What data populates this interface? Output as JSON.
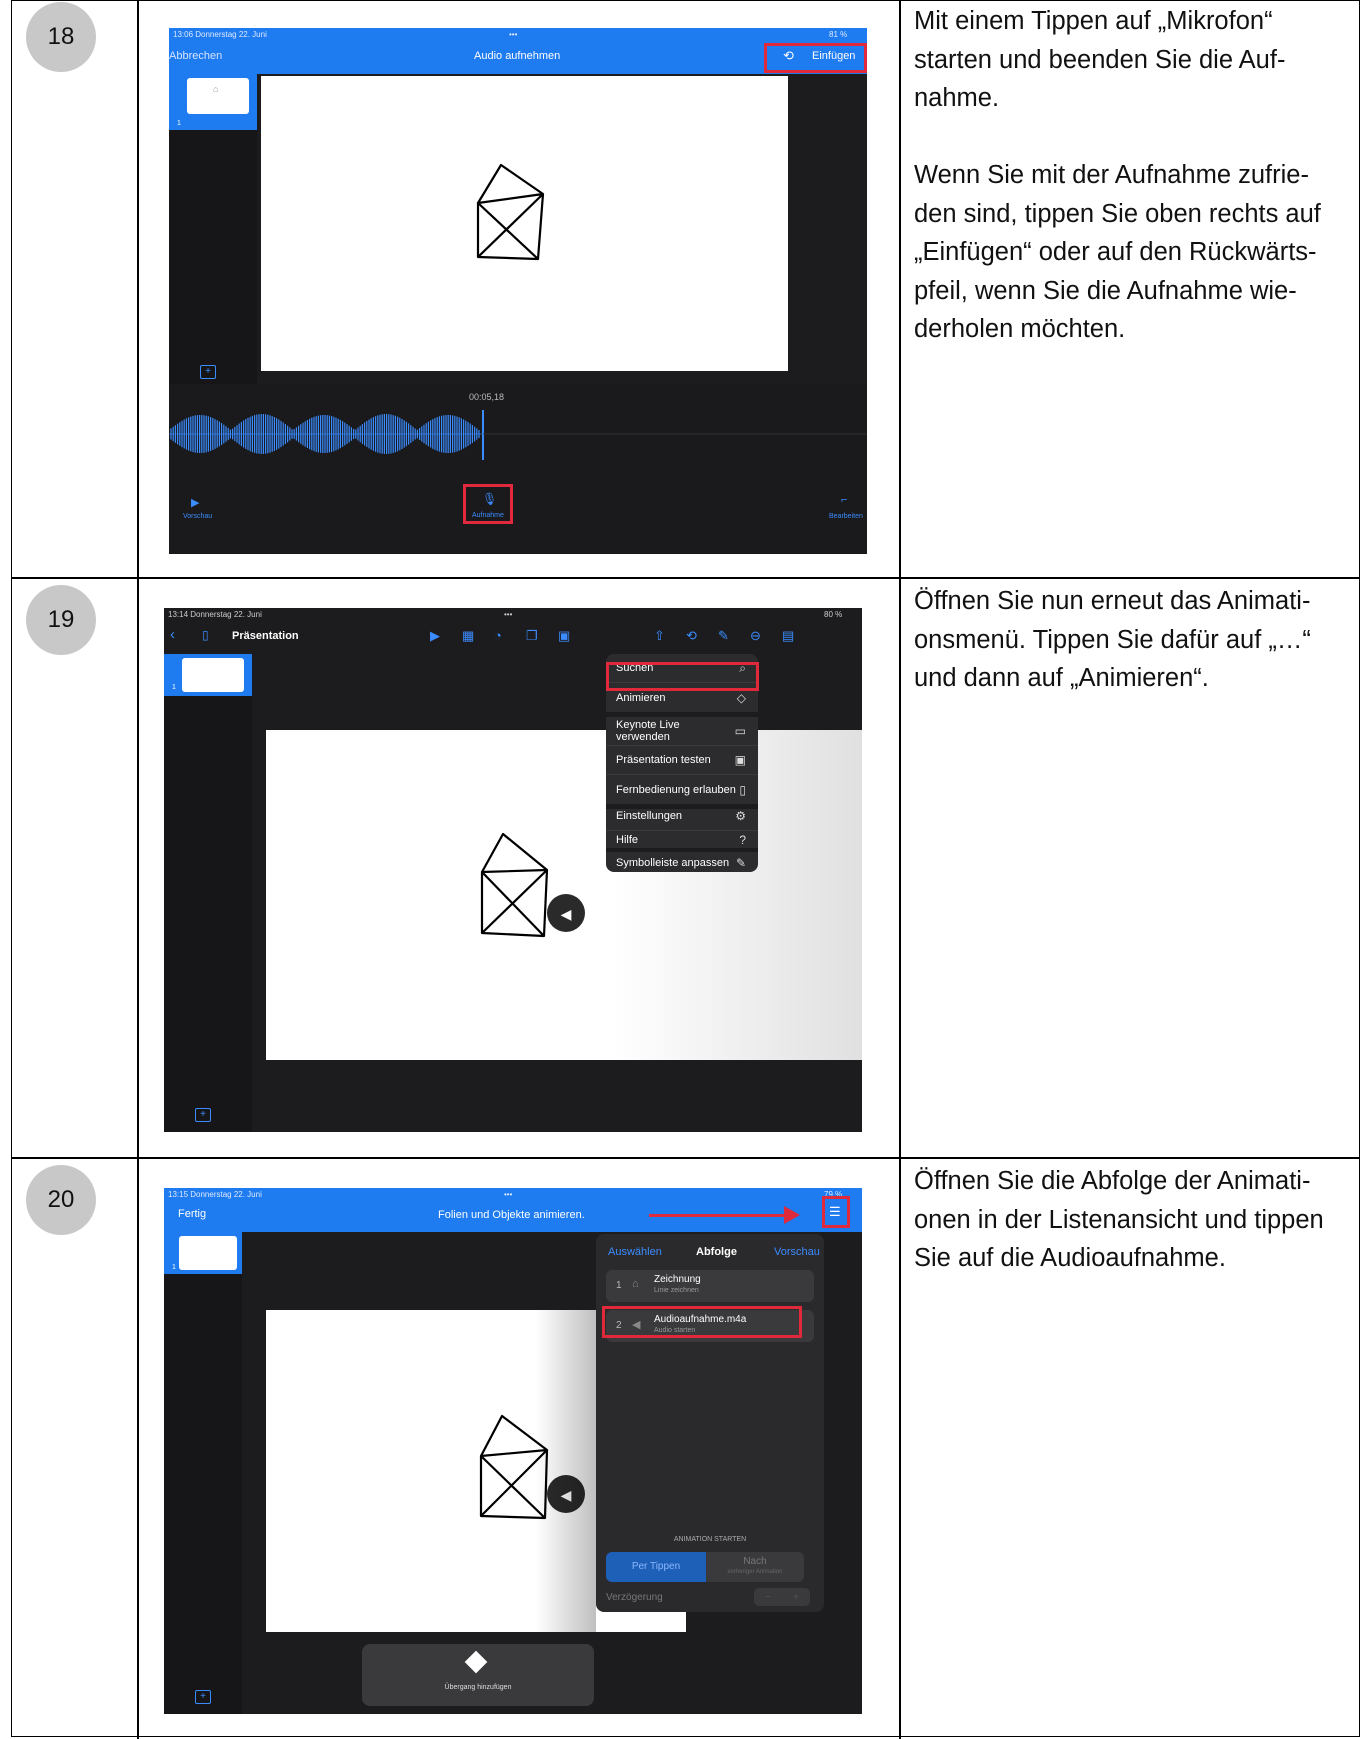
{
  "rows": [
    {
      "number": "18",
      "description": "Mit einem Tippen auf „Mikrofon“ starten und beenden Sie die Auf-\nnahme.\n\nWenn Sie mit der Aufnahme zufrie-\nden sind, tippen Sie oben rechts auf\n„Einfügen“ oder auf den Rückwärts-\npfeil, wenn Sie die Aufnahme wie-\nderholen möchten.",
      "screen": {
        "status_time": "13:06  Donnerstag 22. Juni",
        "status_dots": "•••",
        "status_battery": "81 %",
        "cancel": "Abbrechen",
        "title": "Audio aufnehmen",
        "insert": "Einfügen",
        "timecode": "00:05,18",
        "preview": "Vorschau",
        "record": "Aufnahme",
        "edit": "Bearbeiten",
        "thumb_number": "1"
      }
    },
    {
      "number": "19",
      "description": "Öffnen Sie nun erneut das Animati-\nonsmenü. Tippen Sie dafür auf „…“\nund dann auf „Animieren“.",
      "screen": {
        "status_time": "13:14  Donnerstag 22. Juni",
        "status_dots": "•••",
        "status_battery": "80 %",
        "doc_title": "Präsentation",
        "thumb_number": "1",
        "menu": [
          {
            "label": "Suchen",
            "icon": "⌕"
          },
          {
            "label": "Animieren",
            "icon": "◇"
          },
          {
            "label": "Keynote Live verwenden",
            "icon": "▭"
          },
          {
            "label": "Präsentation testen",
            "icon": "▣"
          },
          {
            "label": "Fernbedienung erlauben",
            "icon": "▯"
          },
          {
            "label": "Einstellungen",
            "icon": "⚙"
          },
          {
            "label": "Hilfe",
            "icon": "?"
          },
          {
            "label": "Symbolleiste anpassen",
            "icon": "✎"
          }
        ]
      }
    },
    {
      "number": "20",
      "description": "Öffnen Sie die Abfolge der  Animati-\nonen in der Listenansicht und tippen\nSie auf die Audioaufnahme.",
      "screen": {
        "status_time": "13:15  Donnerstag 22. Juni",
        "status_dots": "•••",
        "status_battery": "79 %",
        "done": "Fertig",
        "title": "Folien und Objekte animieren.",
        "thumb_number": "1",
        "panel": {
          "select": "Auswählen",
          "heading": "Abfolge",
          "preview": "Vorschau",
          "items": [
            {
              "index": "1",
              "name": "Zeichnung",
              "sub": "Linie zeichnen"
            },
            {
              "index": "2",
              "name": "Audioaufnahme.m4a",
              "sub": "Audio starten"
            }
          ],
          "start_label": "ANIMATION STARTEN",
          "on_tap": "Per Tippen",
          "after": "Nach",
          "after_sub": "vorheriger Animation",
          "delay": "Verzögerung"
        },
        "transition": "Übergang hinzufügen"
      }
    }
  ]
}
